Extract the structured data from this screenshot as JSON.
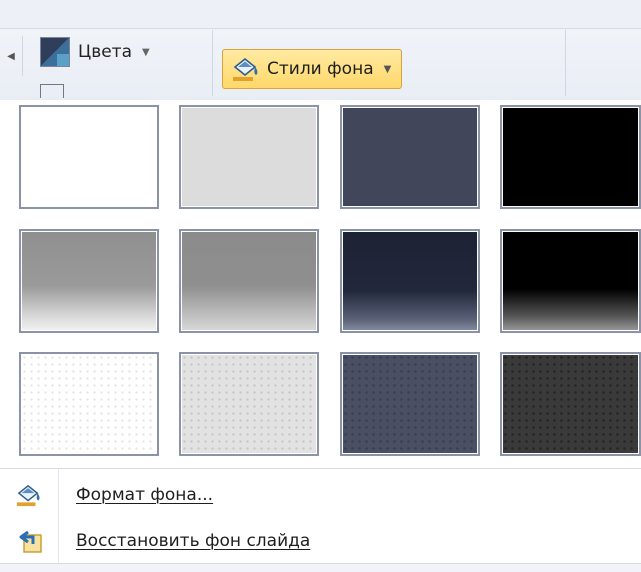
{
  "ribbon": {
    "colors_label": "Цвета",
    "styles_button_label": "Стили фона"
  },
  "gallery": {
    "tiles": [
      {
        "name": "background-style-1"
      },
      {
        "name": "background-style-2"
      },
      {
        "name": "background-style-3"
      },
      {
        "name": "background-style-4"
      },
      {
        "name": "background-style-5"
      },
      {
        "name": "background-style-6"
      },
      {
        "name": "background-style-7"
      },
      {
        "name": "background-style-8"
      },
      {
        "name": "background-style-9"
      },
      {
        "name": "background-style-10"
      },
      {
        "name": "background-style-11"
      },
      {
        "name": "background-style-12"
      }
    ]
  },
  "menu": {
    "format_label": "Формат фона...",
    "reset_label": "Восстановить фон слайда"
  },
  "icons": {
    "colors": "color-palette-icon",
    "styles": "paint-bucket-icon",
    "format": "paint-bucket-icon",
    "reset": "reset-background-icon"
  },
  "colors": {
    "highlight": "#ffd86b",
    "tile_border": "#8a94a6"
  }
}
